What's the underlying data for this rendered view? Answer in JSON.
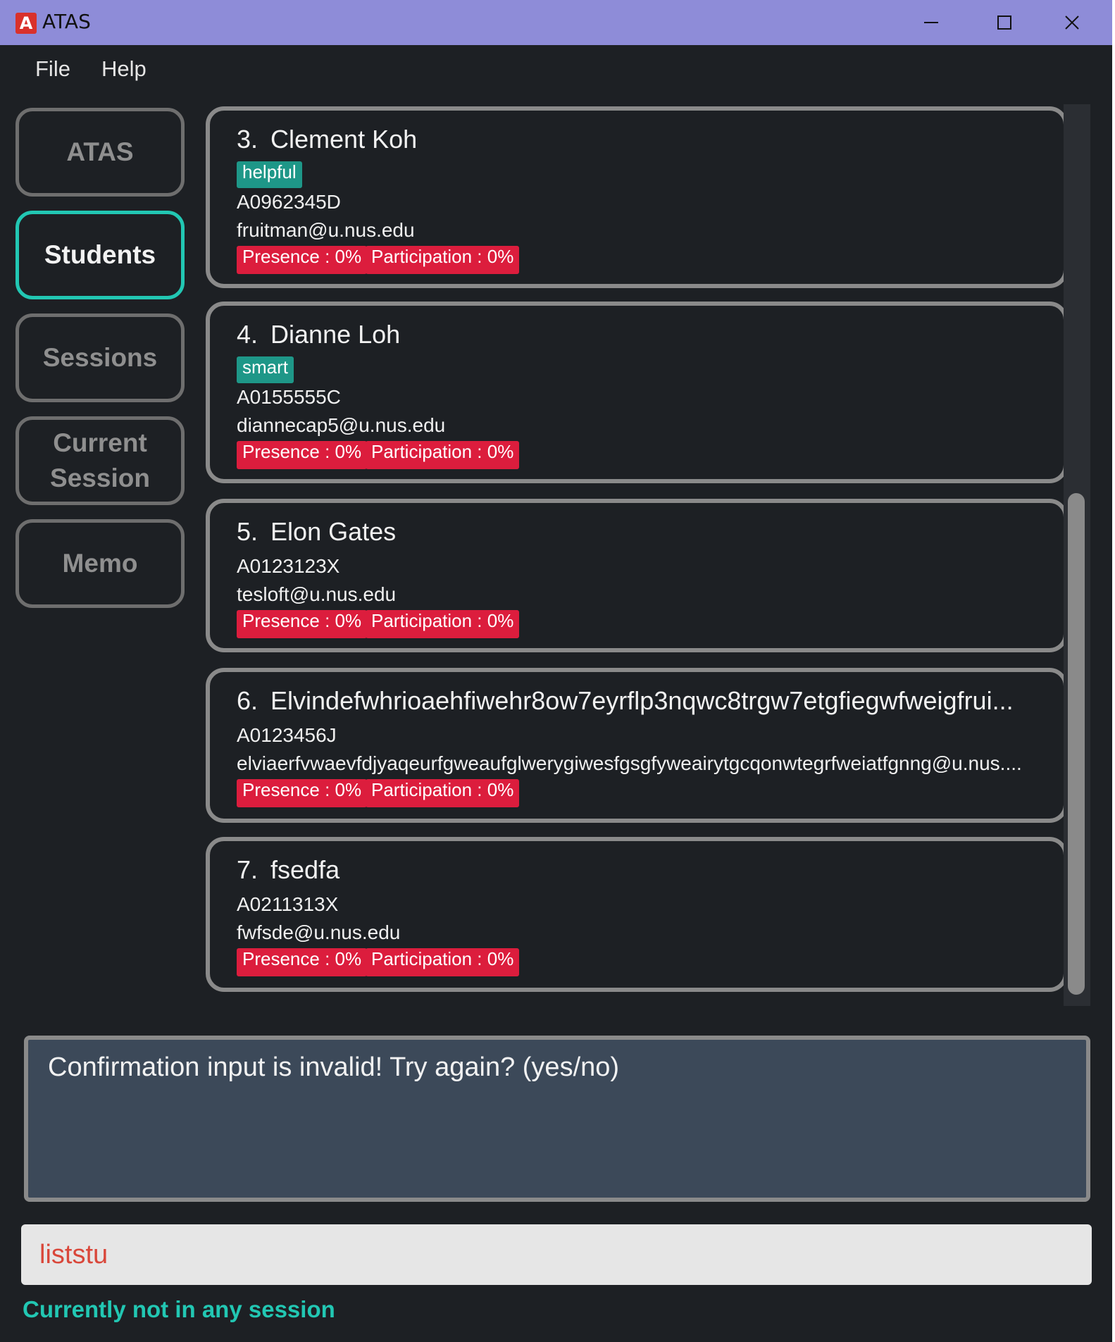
{
  "window": {
    "title": "ATAS",
    "logo_letter": "A",
    "minimize_glyph": "minimize-icon",
    "maximize_glyph": "maximize-icon",
    "close_glyph": "close-icon"
  },
  "menu": {
    "items": [
      {
        "label": "File"
      },
      {
        "label": "Help"
      }
    ]
  },
  "nav": {
    "items": [
      {
        "label": "ATAS",
        "active": false
      },
      {
        "label": "Students",
        "active": true
      },
      {
        "label": "Sessions",
        "active": false
      },
      {
        "label": "Current\nSession",
        "active": false
      },
      {
        "label": "Memo",
        "active": false
      }
    ]
  },
  "students": [
    {
      "index": "3.",
      "name": "Clement Koh",
      "tag": "helpful",
      "matric": "A0962345D",
      "email": "fruitman@u.nus.edu",
      "presence": "Presence : 0%",
      "participation": "Participation : 0%"
    },
    {
      "index": "4.",
      "name": "Dianne Loh",
      "tag": "smart",
      "matric": "A0155555C",
      "email": "diannecap5@u.nus.edu",
      "presence": "Presence : 0%",
      "participation": "Participation : 0%"
    },
    {
      "index": "5.",
      "name": "Elon Gates",
      "tag": "",
      "matric": "A0123123X",
      "email": "tesloft@u.nus.edu",
      "presence": "Presence : 0%",
      "participation": "Participation : 0%"
    },
    {
      "index": "6.",
      "name": "Elvindefwhrioaehfiwehr8ow7eyrflp3nqwc8trgw7etgfiegwfweigfrui...",
      "tag": "",
      "matric": "A0123456J",
      "email": "elviaerfvwaevfdjyaqeurfgweaufglwerygiwesfgsgfyweairytgcqonwtegrfweiatfgnng@u.nus....",
      "presence": "Presence : 0%",
      "participation": "Participation : 0%"
    },
    {
      "index": "7.",
      "name": "fsedfa",
      "tag": "",
      "matric": "A0211313X",
      "email": "fwfsde@u.nus.edu",
      "presence": "Presence : 0%",
      "participation": "Participation : 0%"
    }
  ],
  "result": {
    "message": "Confirmation input is invalid! Try again? (yes/no)"
  },
  "command": {
    "value": "liststu"
  },
  "status": {
    "text": "Currently not in any session"
  },
  "colors": {
    "accent": "#22c7b3",
    "tag": "#1e9788",
    "badge": "#dc1d3d",
    "titlebar": "#8e8cd8"
  }
}
